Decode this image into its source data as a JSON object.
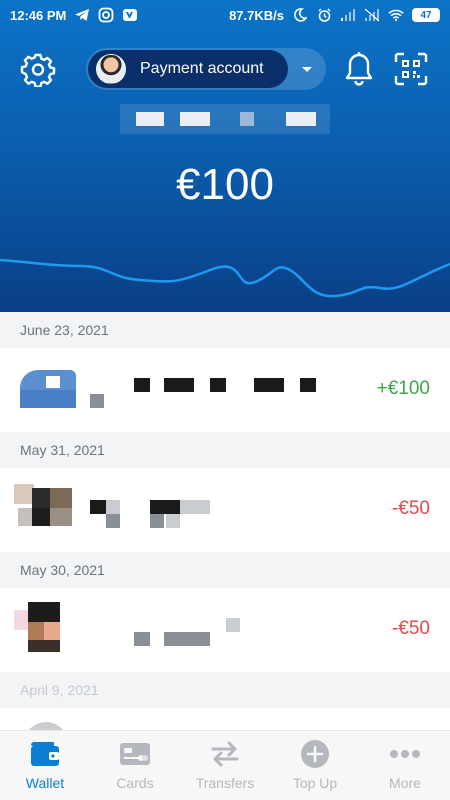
{
  "status_bar": {
    "time": "12:46 PM",
    "network_speed": "87.7KB/s",
    "battery": "47",
    "icons_left": [
      "telegram-icon",
      "instagram-icon",
      "vk-icon"
    ],
    "icons_right": [
      "moon-icon",
      "alarm-icon",
      "signal-icon",
      "signal-icon",
      "wifi-icon",
      "battery-icon"
    ]
  },
  "header": {
    "account_label": "Payment account",
    "balance": "€100",
    "accent": "#0b6fc7"
  },
  "transactions": [
    {
      "date": "June 23, 2021",
      "amount": "+€100",
      "direction": "in"
    },
    {
      "date": "May 31, 2021",
      "amount": "-€50",
      "direction": "out"
    },
    {
      "date": "May 30, 2021",
      "amount": "-€50",
      "direction": "out"
    },
    {
      "date": "April 9, 2021",
      "amount": "",
      "direction": "out"
    }
  ],
  "colors": {
    "positive": "#3fa34d",
    "negative": "#e0484d",
    "nav_active": "#0b7fd2",
    "nav_inactive": "#b4b8be"
  },
  "nav": [
    {
      "label": "Wallet",
      "icon": "wallet-icon",
      "active": true
    },
    {
      "label": "Cards",
      "icon": "card-icon",
      "active": false
    },
    {
      "label": "Transfers",
      "icon": "transfer-icon",
      "active": false
    },
    {
      "label": "Top Up",
      "icon": "plus-circle-icon",
      "active": false
    },
    {
      "label": "More",
      "icon": "more-icon",
      "active": false
    }
  ]
}
